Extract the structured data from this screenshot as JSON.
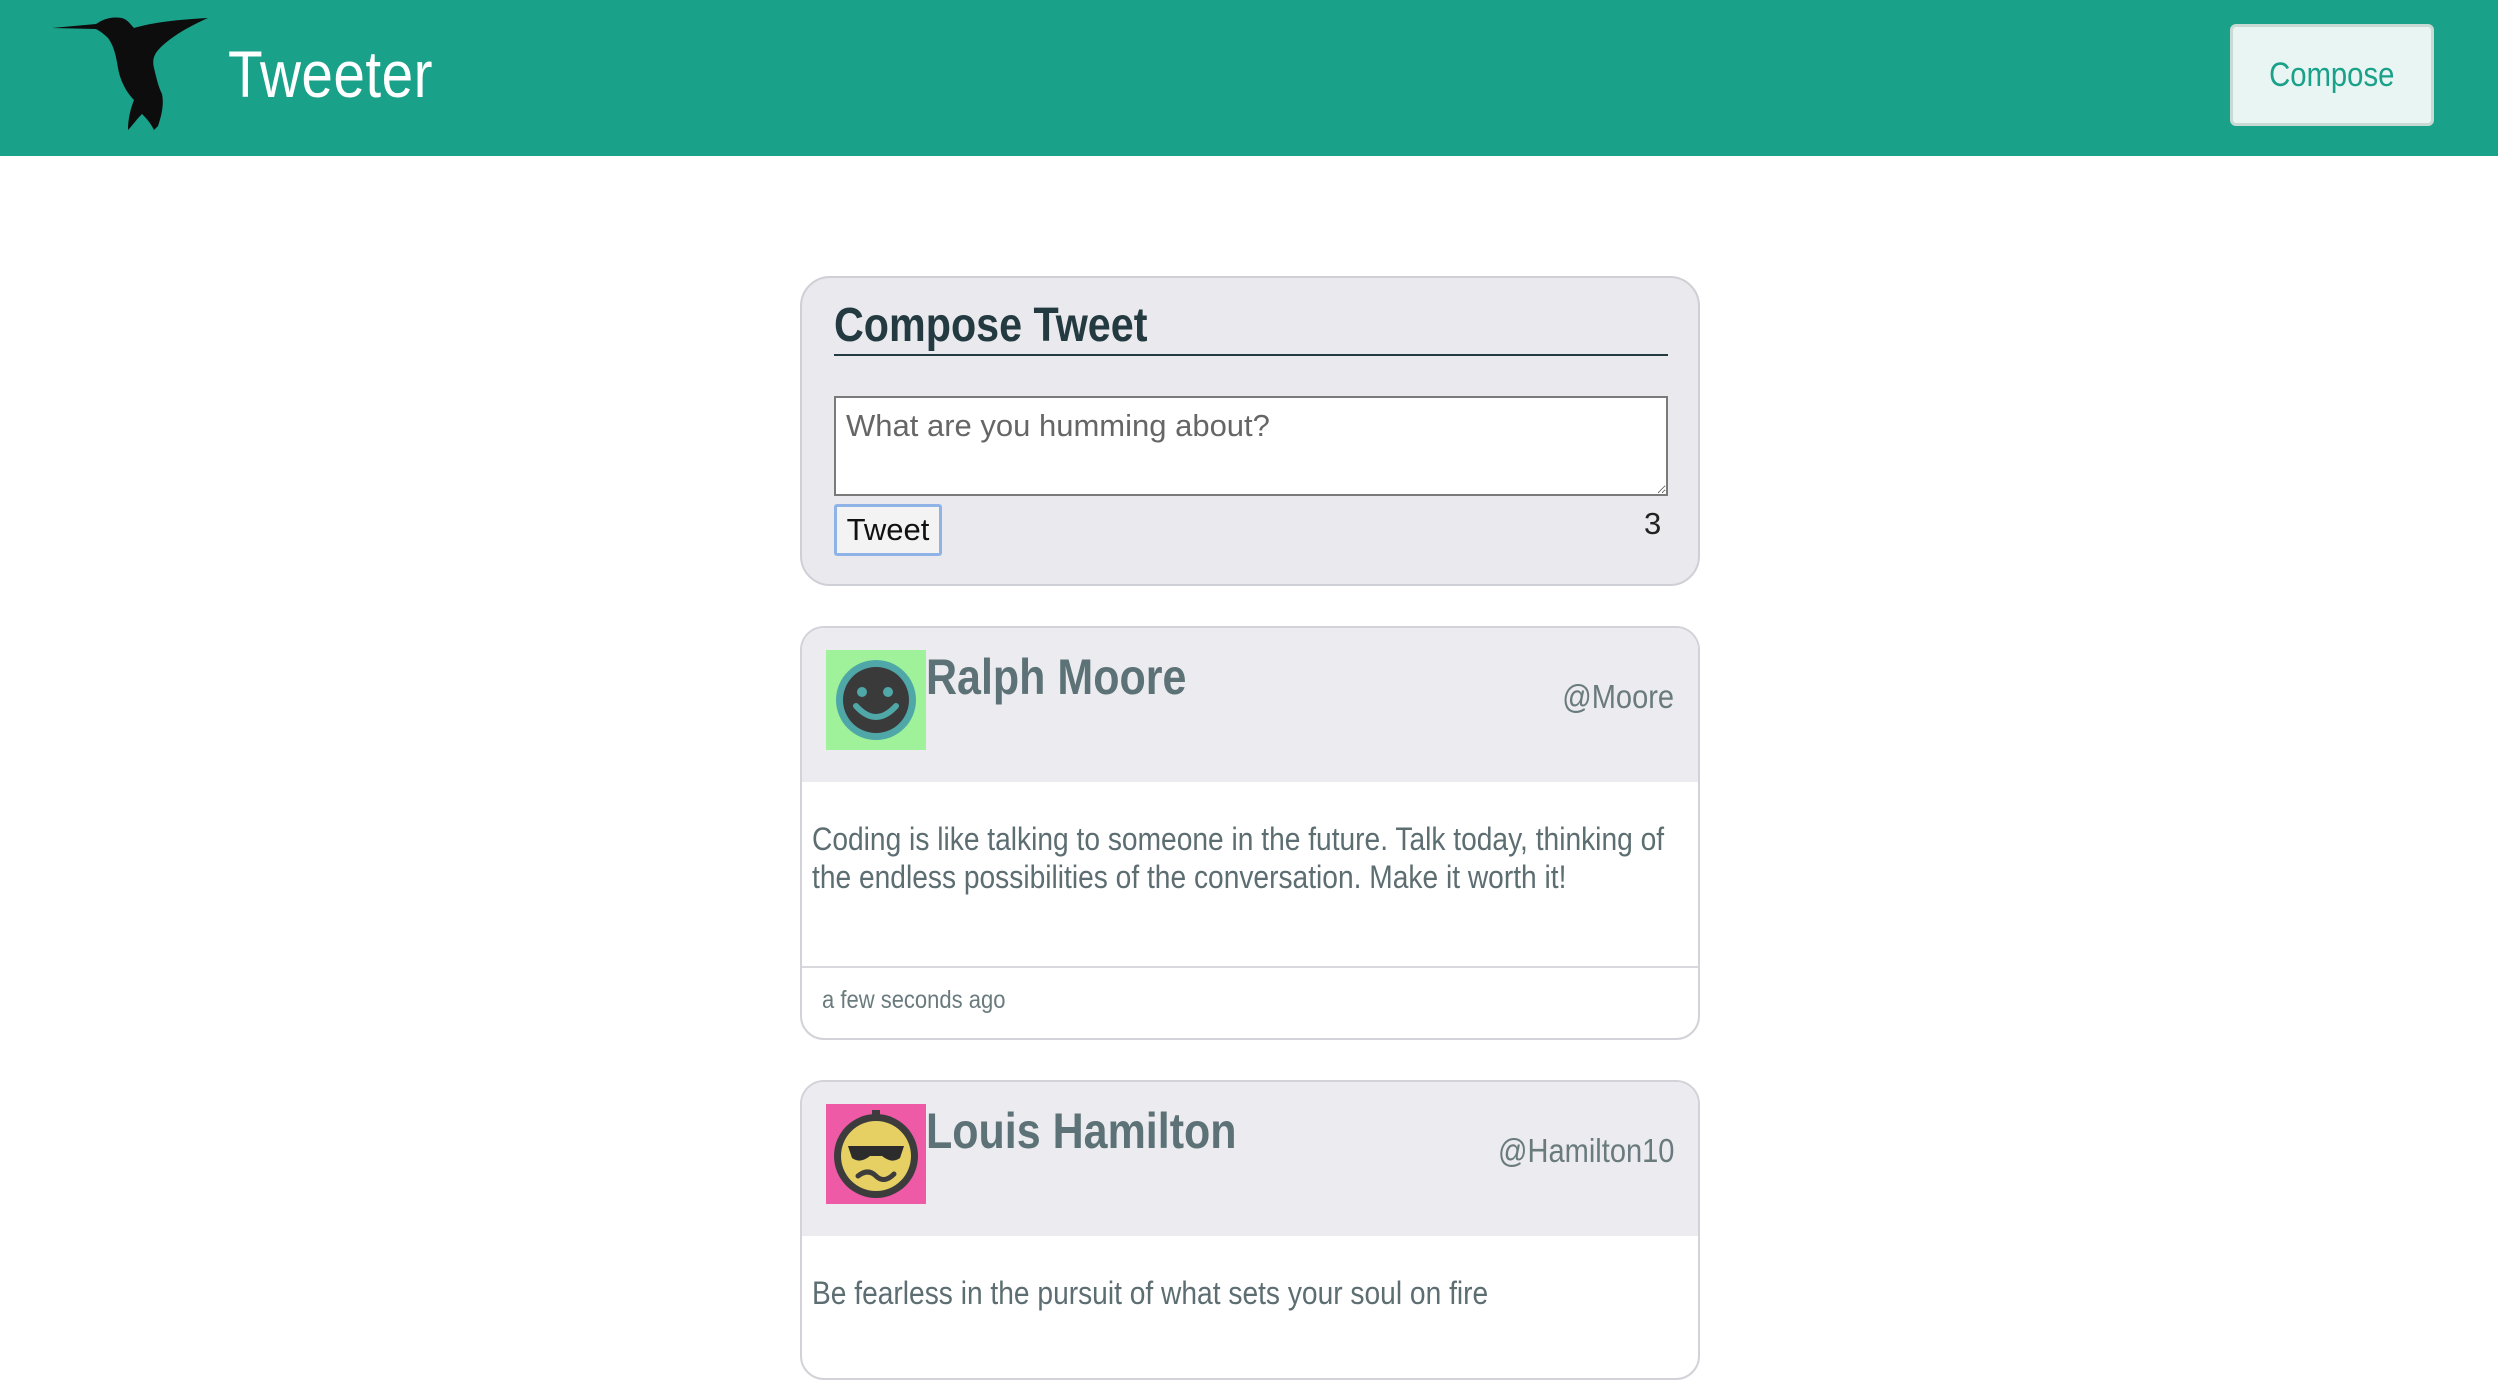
{
  "header": {
    "brand": "Tweeter",
    "compose_label": "Compose",
    "accent_color": "#1aa189"
  },
  "compose": {
    "title": "Compose Tweet",
    "placeholder": "What are you humming about?",
    "value": "",
    "submit_label": "Tweet",
    "counter": "3"
  },
  "tweets": [
    {
      "name": "Ralph Moore",
      "handle": "@Moore",
      "avatar_icon": "smiley-face-icon",
      "avatar_bg": "#9ff29a",
      "text": "Coding is like talking to someone in the future. Talk today, thinking of the endless possibilities of the conversation. Make it worth it!",
      "time": "a few seconds ago"
    },
    {
      "name": "Louis Hamilton",
      "handle": "@Hamilton10",
      "avatar_icon": "sunglasses-face-icon",
      "avatar_bg": "#ee5aa6",
      "text": "Be fearless in the pursuit of what sets your soul on fire",
      "time": ""
    }
  ]
}
